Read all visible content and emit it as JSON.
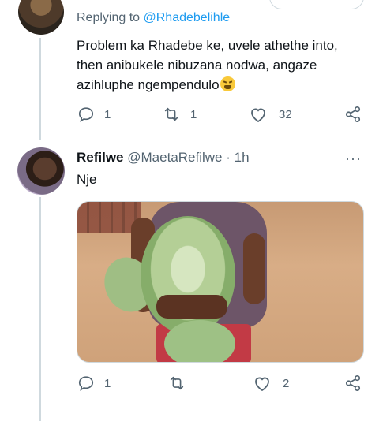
{
  "top_tweet": {
    "replying_prefix": "Replying to ",
    "replying_mention": "@Rhadebelihle",
    "text_lines": [
      "Problem ka Rhadebe ke, uvele athethe into,",
      "then anibukele nibuzana nodwa, angaze",
      "azihluphe ngempendulo"
    ],
    "emoji": "tired-face",
    "actions": {
      "replies": "1",
      "retweets": "1",
      "likes": "32"
    }
  },
  "reply_tweet": {
    "name": "Refilwe",
    "handle": "@MaetaRefilwe",
    "separator": "·",
    "time": "1h",
    "more": "···",
    "text": "Nje",
    "actions": {
      "replies": "1",
      "retweets": "",
      "likes": "2"
    }
  },
  "colors": {
    "text": "#0f1419",
    "secondary": "#536471",
    "accent": "#1d9bf0",
    "divider": "#cfd9de"
  },
  "icons": [
    "reply-icon",
    "retweet-icon",
    "like-icon",
    "share-icon",
    "more-icon"
  ]
}
